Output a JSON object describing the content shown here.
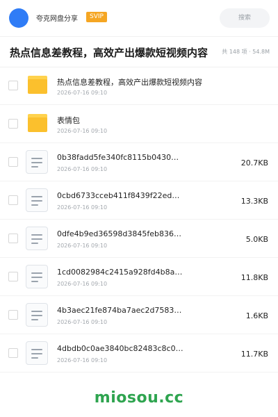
{
  "header": {
    "brand": "夸克网盘分享",
    "badge": "SVIP",
    "search_placeholder": "搜索"
  },
  "title_bar": {
    "title": "热点信息差教程，高效产出爆款短视频内容",
    "meta": "共 148 项 · 54.8M"
  },
  "files": [
    {
      "type": "folder",
      "name": "热点信息差教程，高效产出爆款短视频内容",
      "date": "2026-07-16 09:10",
      "size": ""
    },
    {
      "type": "folder",
      "name": "表情包",
      "date": "2026-07-16 09:10",
      "size": ""
    },
    {
      "type": "file",
      "name": "0b38fadd5fe340fc8115b0430…",
      "date": "2026-07-16 09:10",
      "size": "20.7KB"
    },
    {
      "type": "file",
      "name": "0cbd6733cceb411f8439f22ed…",
      "date": "2026-07-16 09:10",
      "size": "13.3KB"
    },
    {
      "type": "file",
      "name": "0dfe4b9ed36598d3845feb836…",
      "date": "2026-07-16 09:10",
      "size": "5.0KB"
    },
    {
      "type": "file",
      "name": "1cd0082984c2415a928fd4b8a…",
      "date": "2026-07-16 09:10",
      "size": "11.8KB"
    },
    {
      "type": "file",
      "name": "4b3aec21fe874ba7aec2d7583…",
      "date": "2026-07-16 09:10",
      "size": "1.6KB"
    },
    {
      "type": "file",
      "name": "4dbdb0c0ae3840bc82483c8c0…",
      "date": "2026-07-16 09:10",
      "size": "11.7KB"
    }
  ],
  "footer": {
    "watermark": "miosou.cc"
  },
  "colors": {
    "accent": "#2f7cf6",
    "badge": "#f5a623",
    "folder": "#fbc02d",
    "watermark": "#2ea44f"
  }
}
